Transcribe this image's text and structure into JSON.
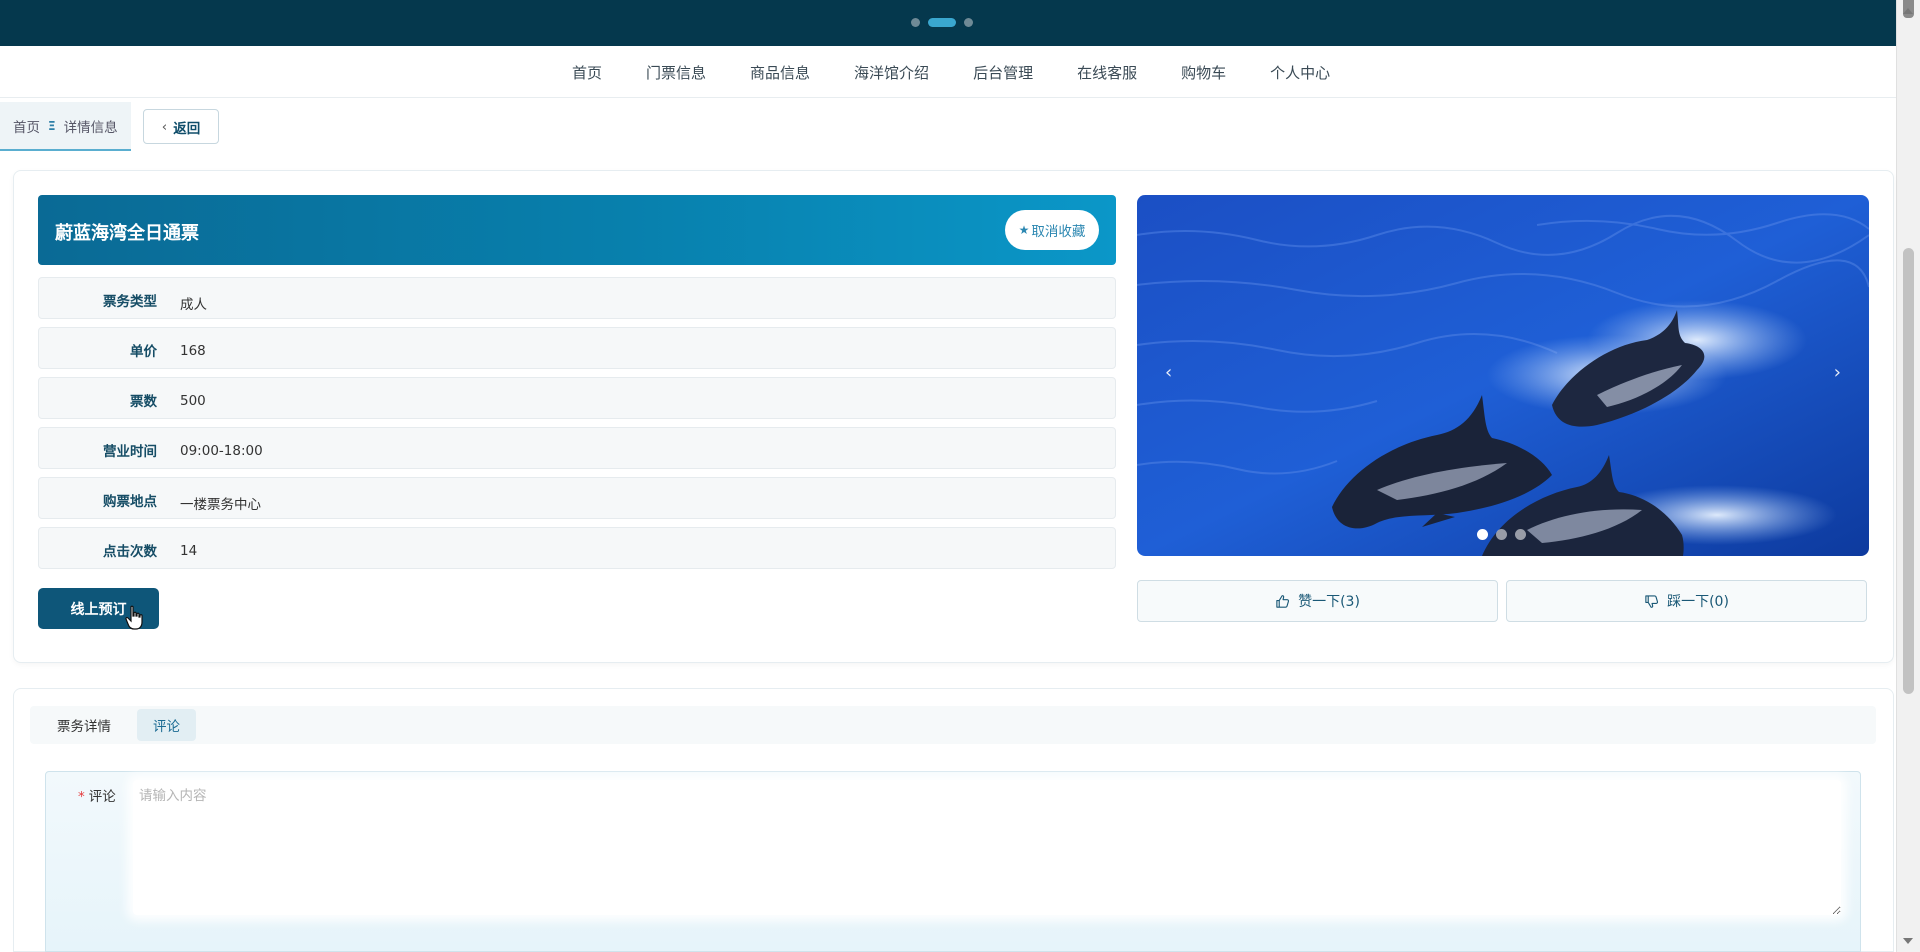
{
  "nav": {
    "items": [
      "首页",
      "门票信息",
      "商品信息",
      "海洋馆介绍",
      "后台管理",
      "在线客服",
      "购物车",
      "个人中心"
    ]
  },
  "breadcrumb": {
    "home": "首页",
    "separator": "Ξ",
    "current": "详情信息"
  },
  "back_label": "返回",
  "detail": {
    "title": "蔚蓝海湾全日通票",
    "fav_label": "取消收藏",
    "fields": [
      {
        "label": "票务类型",
        "value": "成人"
      },
      {
        "label": "单价",
        "value": "168"
      },
      {
        "label": "票数",
        "value": "500"
      },
      {
        "label": "营业时间",
        "value": "09:00-18:00"
      },
      {
        "label": "购票地点",
        "value": "一楼票务中心"
      },
      {
        "label": "点击次数",
        "value": "14"
      }
    ],
    "book_label": "线上预订"
  },
  "carousel": {
    "slide_count": 3,
    "active_index": 0
  },
  "votes": {
    "like_label": "赞一下(3)",
    "dislike_label": "踩一下(0)"
  },
  "tabs": [
    {
      "label": "票务详情",
      "active": false
    },
    {
      "label": "评论",
      "active": true
    }
  ],
  "comment": {
    "label": "评论",
    "required_mark": "*",
    "placeholder": "请输入内容"
  },
  "colors": {
    "header": "#05384d",
    "accent": "#0e5679",
    "title_gradient_start": "#0a6a95",
    "title_gradient_end": "#0b97c8"
  }
}
